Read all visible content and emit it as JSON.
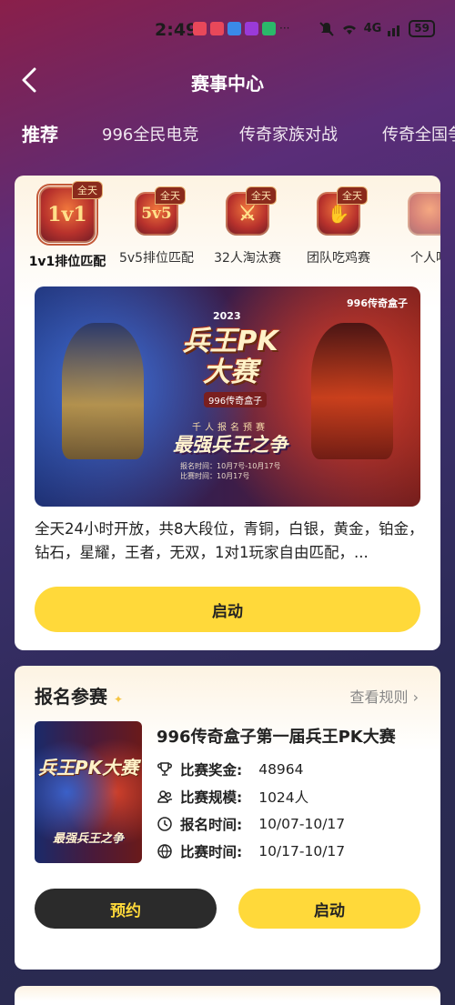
{
  "status_bar": {
    "time": "2:49",
    "more": "···",
    "network": "4G",
    "battery": "59"
  },
  "nav": {
    "title": "赛事中心"
  },
  "tabs": [
    {
      "label": "推荐",
      "active": true
    },
    {
      "label": "996全民电竞",
      "active": false
    },
    {
      "label": "传奇家族对战",
      "active": false
    },
    {
      "label": "传奇全国争",
      "active": false
    }
  ],
  "modes": [
    {
      "label": "1v1排位匹配",
      "icon_text": "1v1",
      "badge": "全天",
      "selected": true
    },
    {
      "label": "5v5排位匹配",
      "icon_text": "5v5",
      "badge": "全天",
      "selected": false
    },
    {
      "label": "32人淘汰赛",
      "icon_text": "⚔",
      "badge": "全天",
      "selected": false
    },
    {
      "label": "团队吃鸡赛",
      "icon_text": "✋",
      "badge": "全天",
      "selected": false
    },
    {
      "label": "个人吃",
      "icon_text": "",
      "badge": "",
      "selected": false
    }
  ],
  "banner": {
    "logo": "996传奇盒子",
    "year": "2023",
    "title": "兵王PK大赛",
    "subtitle": "996传奇盒子",
    "tagline": "千人报名预赛",
    "slogan": "最强兵王之争",
    "signup_time": "报名时间：10月7号-10月17号",
    "match_time": "比赛时间：10月17号"
  },
  "description": "全天24小时开放，共8大段位，青铜，白银，黄金，铂金，钻石，星耀，王者，无双，1对1玩家自由匹配，...",
  "launch_label": "启动",
  "signup_section": {
    "title": "报名参赛",
    "rules_link": "查看规则",
    "event_name": "996传奇盒子第一届兵王PK大赛",
    "poster": {
      "title": "兵王PK大赛",
      "slogan": "最强兵王之争"
    },
    "info": {
      "prize_label": "比赛奖金:",
      "prize_value": "48964",
      "scale_label": "比赛规模:",
      "scale_value": "1024人",
      "signup_label": "报名时间:",
      "signup_value": "10/07-10/17",
      "match_label": "比赛时间:",
      "match_value": "10/17-10/17"
    },
    "reserve_label": "预约",
    "launch_label": "启动"
  },
  "colors": {
    "accent_yellow": "#ffd93a",
    "dark_button": "#2b2b2b"
  }
}
